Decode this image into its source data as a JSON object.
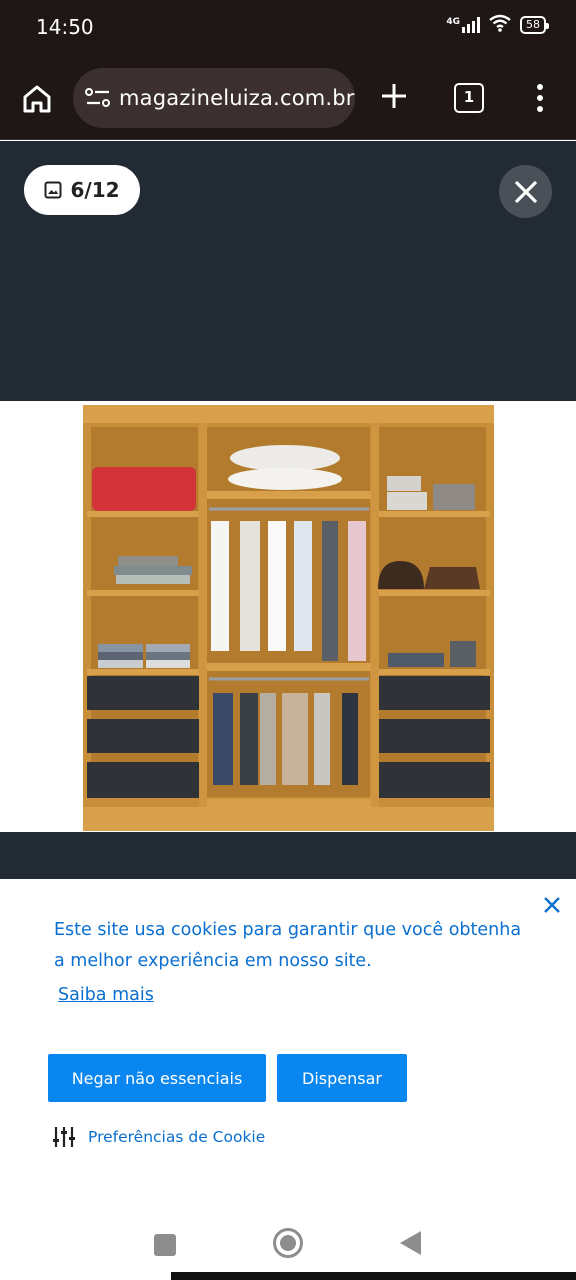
{
  "status_bar": {
    "time": "14:50",
    "network": "4G",
    "battery": "58",
    "icons": [
      "signal-icon",
      "wifi-icon",
      "battery-icon"
    ]
  },
  "browser": {
    "url": "magazineluiza.com.br",
    "tab_count": "1",
    "icons": [
      "home-icon",
      "site-settings-icon",
      "new-tab-icon",
      "tabs-icon",
      "overflow-menu-icon"
    ]
  },
  "viewer": {
    "counter": "6/12",
    "icons": [
      "image-icon",
      "close-icon"
    ]
  },
  "cookie_banner": {
    "message": "Este site usa cookies para garantir que você obtenha a melhor experiência em nosso site.",
    "learn_more": "Saiba mais",
    "deny_button": "Negar não essenciais",
    "dismiss_button": "Dispensar",
    "preferences": "Preferências de Cookie",
    "colors": {
      "link": "#0a6fd0",
      "button": "#0a86f0"
    }
  },
  "colors": {
    "browser_chrome": "#1f1616",
    "viewer_background": "#222a33",
    "wood": "#c98e3a",
    "drawer_front": "#2f3338"
  }
}
